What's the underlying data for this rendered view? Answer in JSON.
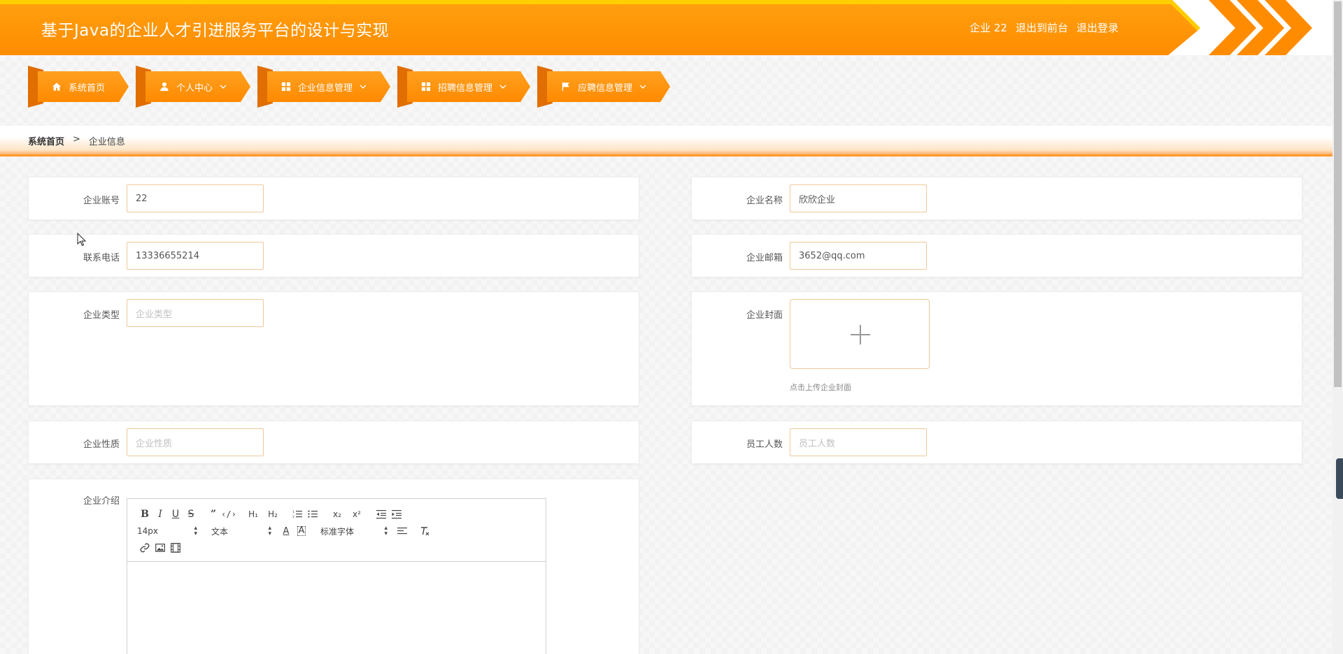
{
  "header": {
    "title": "基于Java的企业人才引进服务平台的设计与实现",
    "user": "企业 22",
    "front_link": "退出到前台",
    "logout_link": "退出登录"
  },
  "nav": {
    "items": [
      {
        "label": "系统首页",
        "icon": "home-icon",
        "dropdown": false
      },
      {
        "label": "个人中心",
        "icon": "user-icon",
        "dropdown": true
      },
      {
        "label": "企业信息管理",
        "icon": "grid-icon",
        "dropdown": true
      },
      {
        "label": "招聘信息管理",
        "icon": "grid-icon",
        "dropdown": true
      },
      {
        "label": "应聘信息管理",
        "icon": "flag-icon",
        "dropdown": true
      }
    ]
  },
  "breadcrumb": {
    "home": "系统首页",
    "separator": ">",
    "current": "企业信息"
  },
  "form": {
    "account": {
      "label": "企业账号",
      "value": "22"
    },
    "name": {
      "label": "企业名称",
      "value": "欣欣企业"
    },
    "phone": {
      "label": "联系电话",
      "value": "13336655214"
    },
    "email": {
      "label": "企业邮箱",
      "value": "3652@qq.com"
    },
    "type": {
      "label": "企业类型",
      "placeholder": "企业类型"
    },
    "cover": {
      "label": "企业封面",
      "hint": "点击上传企业封面"
    },
    "nature": {
      "label": "企业性质",
      "placeholder": "企业性质"
    },
    "employees": {
      "label": "员工人数",
      "placeholder": "员工人数"
    },
    "intro": {
      "label": "企业介绍"
    }
  },
  "editor": {
    "font_size": "14px",
    "block_format": "文本",
    "font_family": "标准字体"
  },
  "colors": {
    "primary": "#ff8c00",
    "accent_yellow": "#ffcc00",
    "field_border": "#f0c89a"
  }
}
